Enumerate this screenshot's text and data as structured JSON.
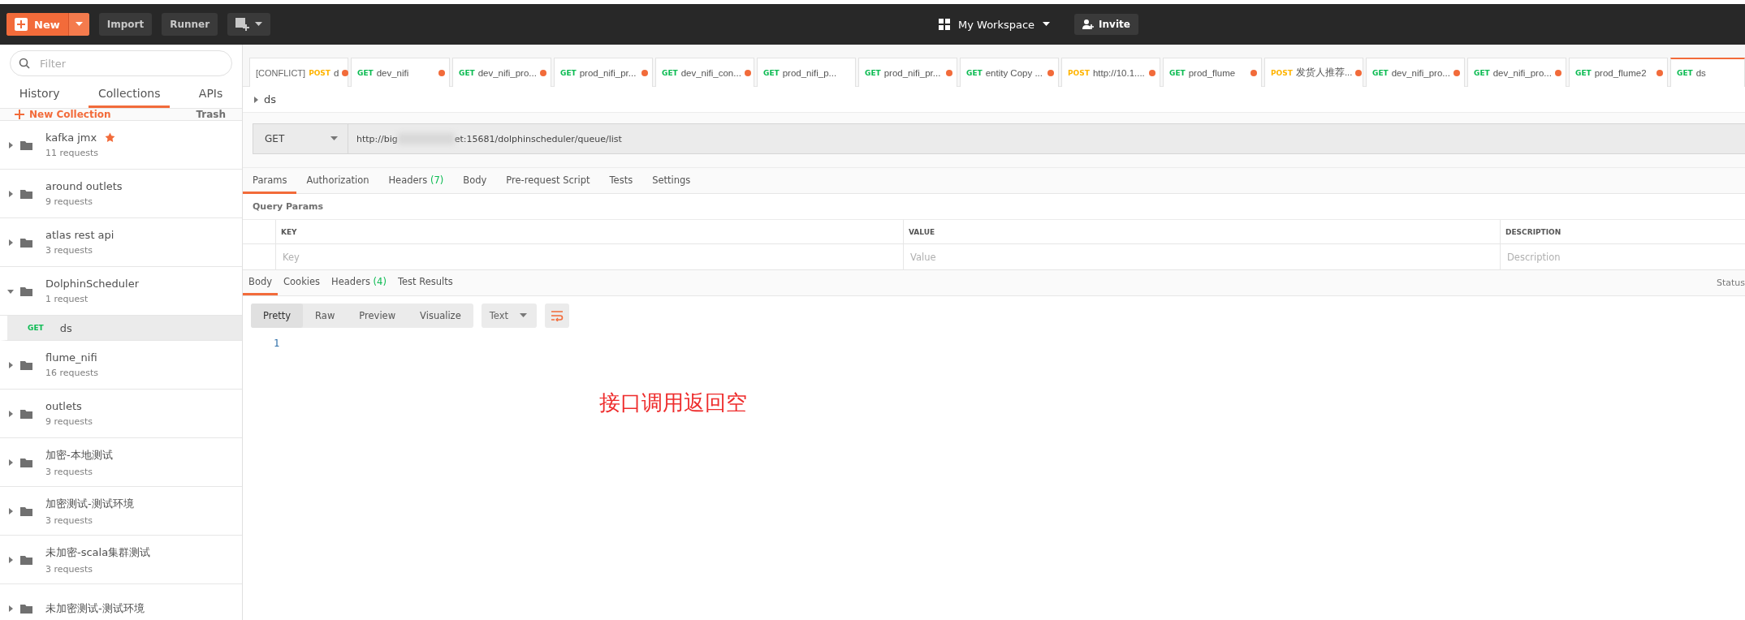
{
  "header": {
    "new_button": "New",
    "buttons": [
      "Import",
      "Runner"
    ],
    "workspace": "My Workspace",
    "invite": "Invite"
  },
  "sidebar": {
    "filter_placeholder": "Filter",
    "tabs": [
      {
        "label": "History",
        "selected": false
      },
      {
        "label": "Collections",
        "selected": true
      },
      {
        "label": "APIs",
        "selected": false
      }
    ],
    "new_collection": "New Collection",
    "trash": "Trash",
    "collections": [
      {
        "name": "kafka jmx",
        "count": "11 requests",
        "starred": true,
        "expanded": false
      },
      {
        "name": "around outlets",
        "count": "9 requests",
        "starred": false,
        "expanded": false
      },
      {
        "name": "atlas rest api",
        "count": "3 requests",
        "starred": false,
        "expanded": false
      },
      {
        "name": "DolphinScheduler",
        "count": "1 request",
        "starred": false,
        "expanded": true,
        "children": [
          {
            "method": "GET",
            "name": "ds",
            "selected": true
          }
        ]
      },
      {
        "name": "flume_nifi",
        "count": "16 requests",
        "starred": false,
        "expanded": false
      },
      {
        "name": "outlets",
        "count": "9 requests",
        "starred": false,
        "expanded": false
      },
      {
        "name": "加密-本地测试",
        "count": "3 requests",
        "starred": false,
        "expanded": false
      },
      {
        "name": "加密测试-测试环境",
        "count": "3 requests",
        "starred": false,
        "expanded": false
      },
      {
        "name": "未加密-scala集群测试",
        "count": "3 requests",
        "starred": false,
        "expanded": false
      },
      {
        "name": "未加密测试-测试环境",
        "starred": false,
        "expanded": false
      }
    ]
  },
  "request_tabs": [
    {
      "prefix": "[CONFLICT]",
      "method": "POST",
      "name": "d",
      "unsaved": true,
      "selected": false
    },
    {
      "method": "GET",
      "name": "dev_nifi",
      "unsaved": true,
      "selected": false
    },
    {
      "method": "GET",
      "name": "dev_nifi_pro...",
      "unsaved": true,
      "selected": false
    },
    {
      "method": "GET",
      "name": "prod_nifi_pr...",
      "unsaved": true,
      "selected": false
    },
    {
      "method": "GET",
      "name": "dev_nifi_con...",
      "unsaved": true,
      "selected": false
    },
    {
      "method": "GET",
      "name": "prod_nifi_p...",
      "unsaved": false,
      "selected": false
    },
    {
      "method": "GET",
      "name": "prod_nifi_pr...",
      "unsaved": true,
      "selected": false
    },
    {
      "method": "GET",
      "name": "entity Copy ...",
      "unsaved": true,
      "selected": false
    },
    {
      "method": "POST",
      "name": "http://10.1....",
      "unsaved": true,
      "selected": false
    },
    {
      "method": "GET",
      "name": "prod_flume",
      "unsaved": true,
      "selected": false
    },
    {
      "method": "POST",
      "name": "发货人推荐...",
      "unsaved": true,
      "selected": false
    },
    {
      "method": "GET",
      "name": "dev_nifi_pro...",
      "unsaved": true,
      "selected": false
    },
    {
      "method": "GET",
      "name": "dev_nifi_pro...",
      "unsaved": true,
      "selected": false
    },
    {
      "method": "GET",
      "name": "prod_flume2",
      "unsaved": true,
      "selected": false
    },
    {
      "method": "GET",
      "name": "ds",
      "unsaved": false,
      "selected": true
    }
  ],
  "breadcrumb": "ds",
  "request": {
    "method": "GET",
    "url_start": "http://big",
    "url_end": "et:15681/dolphinscheduler/queue/list"
  },
  "request_sections": [
    {
      "label": "Params",
      "selected": true
    },
    {
      "label": "Authorization",
      "selected": false
    },
    {
      "label": "Headers",
      "count": "(7)",
      "selected": false
    },
    {
      "label": "Body",
      "selected": false
    },
    {
      "label": "Pre-request Script",
      "selected": false
    },
    {
      "label": "Tests",
      "selected": false
    },
    {
      "label": "Settings",
      "selected": false
    }
  ],
  "query_params": {
    "title": "Query Params",
    "columns": [
      "KEY",
      "VALUE",
      "DESCRIPTION"
    ],
    "placeholders": [
      "Key",
      "Value",
      "Description"
    ]
  },
  "response_tabs": [
    {
      "label": "Body",
      "selected": true
    },
    {
      "label": "Cookies",
      "selected": false
    },
    {
      "label": "Headers",
      "count": "(4)",
      "selected": false
    },
    {
      "label": "Test Results",
      "selected": false
    }
  ],
  "status": "Status",
  "view_modes": [
    {
      "label": "Pretty",
      "selected": true
    },
    {
      "label": "Raw",
      "selected": false
    },
    {
      "label": "Preview",
      "selected": false
    },
    {
      "label": "Visualize",
      "selected": false
    }
  ],
  "format": "Text",
  "line_numbers": [
    "1"
  ],
  "annotation": "接口调用返回空"
}
